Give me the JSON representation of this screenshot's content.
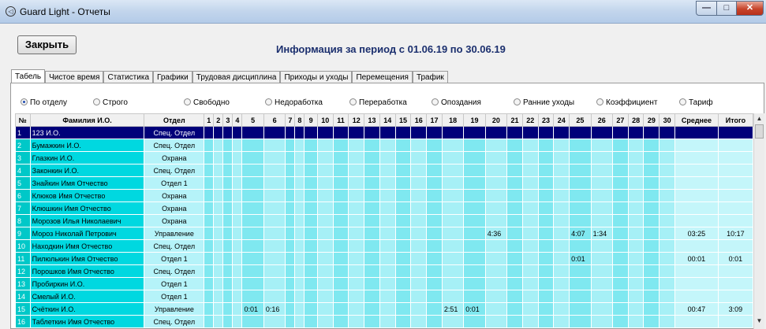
{
  "window": {
    "title": "Guard Light - Отчеты",
    "minimize": "—",
    "maximize": "□",
    "close": "✕",
    "app_icon": "◁"
  },
  "toolbar": {
    "close_label": "Закрыть",
    "period_text": "Информация за период с 01.06.19 по 30.06.19"
  },
  "tabs": [
    {
      "label": "Табель",
      "active": true
    },
    {
      "label": "Чистое время"
    },
    {
      "label": "Статистика"
    },
    {
      "label": "Графики"
    },
    {
      "label": "Трудовая дисциплина"
    },
    {
      "label": "Приходы и уходы"
    },
    {
      "label": "Перемещения"
    },
    {
      "label": "Трафик"
    }
  ],
  "options": [
    {
      "label": "По отделу",
      "checked": true
    },
    {
      "label": "Строго"
    },
    {
      "label": "Свободно"
    },
    {
      "label": "Недоработка"
    },
    {
      "label": "Переработка"
    },
    {
      "label": "Опоздания"
    },
    {
      "label": "Ранние уходы"
    },
    {
      "label": "Коэффициент"
    },
    {
      "label": "Тариф"
    }
  ],
  "table": {
    "headers": [
      "№",
      "Фамилия И.О.",
      "Отдел",
      "1",
      "2",
      "3",
      "4",
      "5",
      "6",
      "7",
      "8",
      "9",
      "10",
      "11",
      "12",
      "13",
      "14",
      "15",
      "16",
      "17",
      "18",
      "19",
      "20",
      "21",
      "22",
      "23",
      "24",
      "25",
      "26",
      "27",
      "28",
      "29",
      "30",
      "Среднее",
      "Итого"
    ],
    "rows": [
      {
        "num": "1",
        "name": "123 И.О.",
        "dept": "Спец. Отдел",
        "selected": true,
        "days": {},
        "avg": "",
        "total": ""
      },
      {
        "num": "2",
        "name": "Бумажкин И.О.",
        "dept": "Спец. Отдел",
        "days": {},
        "avg": "",
        "total": ""
      },
      {
        "num": "3",
        "name": "Глазкин И.О.",
        "dept": "Охрана",
        "days": {},
        "avg": "",
        "total": ""
      },
      {
        "num": "4",
        "name": "Законкин И.О.",
        "dept": "Спец. Отдел",
        "days": {},
        "avg": "",
        "total": ""
      },
      {
        "num": "5",
        "name": "Знайкин Имя Отчество",
        "dept": "Отдел 1",
        "days": {},
        "avg": "",
        "total": ""
      },
      {
        "num": "6",
        "name": "Клюков Имя Отчество",
        "dept": "Охрана",
        "days": {},
        "avg": "",
        "total": ""
      },
      {
        "num": "7",
        "name": "Клюшкин Имя Отчество",
        "dept": "Охрана",
        "days": {},
        "avg": "",
        "total": ""
      },
      {
        "num": "8",
        "name": "Морозов Илья Николаевич",
        "dept": "Охрана",
        "days": {},
        "avg": "",
        "total": ""
      },
      {
        "num": "9",
        "name": "Мороз Николай Петрович",
        "dept": "Управление",
        "days": {
          "20": "4:36",
          "25": "4:07",
          "26": "1:34"
        },
        "avg": "03:25",
        "total": "10:17"
      },
      {
        "num": "10",
        "name": "Находкин Имя Отчество",
        "dept": "Спец. Отдел",
        "days": {},
        "avg": "",
        "total": ""
      },
      {
        "num": "11",
        "name": "Пилюлькин Имя Отчество",
        "dept": "Отдел 1",
        "days": {
          "25": "0:01"
        },
        "avg": "00:01",
        "total": "0:01"
      },
      {
        "num": "12",
        "name": "Порошков Имя Отчество",
        "dept": "Спец. Отдел",
        "days": {},
        "avg": "",
        "total": ""
      },
      {
        "num": "13",
        "name": "Пробиркин И.О.",
        "dept": "Отдел 1",
        "days": {},
        "avg": "",
        "total": ""
      },
      {
        "num": "14",
        "name": "Смелый И.О.",
        "dept": "Отдел 1",
        "days": {},
        "avg": "",
        "total": ""
      },
      {
        "num": "15",
        "name": "Счёткин И.О.",
        "dept": "Управление",
        "days": {
          "5": "0:01",
          "6": "0:16",
          "18": "2:51",
          "19": "0:01"
        },
        "avg": "00:47",
        "total": "3:09"
      },
      {
        "num": "16",
        "name": "Таблеткин Имя Отчество",
        "dept": "Спец. Отдел",
        "days": {},
        "avg": "",
        "total": ""
      }
    ]
  },
  "colors": {
    "selected_row": "#00007a",
    "cell_cyan": "#7fe8f0",
    "name_cyan": "#00d8e0",
    "period_text": "#1b2f6e"
  }
}
